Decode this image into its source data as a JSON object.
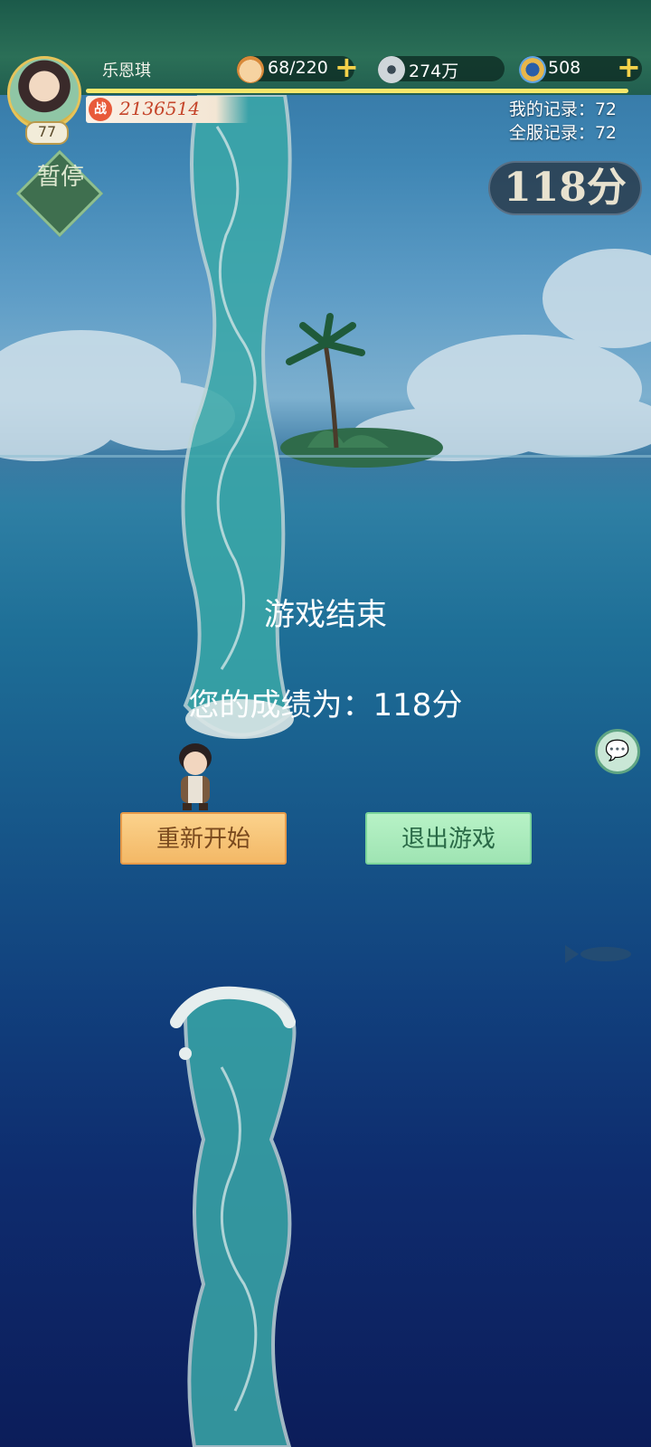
{
  "player": {
    "name": "乐恩琪",
    "level": "77",
    "power": "2136514",
    "power_icon": "战"
  },
  "resources": [
    {
      "icon": "bun-icon",
      "value": "68/220"
    },
    {
      "icon": "coin-icon",
      "value": "274万"
    },
    {
      "icon": "jade-icon",
      "value": "508"
    }
  ],
  "records": {
    "mine": "我的记录：72",
    "server": "全服记录：72"
  },
  "pause_label": "暂停",
  "score_badge": "118分",
  "game_over": {
    "title": "游戏结束",
    "score_line": "您的成绩为：118分"
  },
  "buttons": {
    "restart": "重新开始",
    "exit": "退出游戏"
  },
  "colors": {
    "restart_bg": "#f3b866",
    "exit_bg": "#9fe4b3",
    "accent_gold": "#f4d24a"
  }
}
